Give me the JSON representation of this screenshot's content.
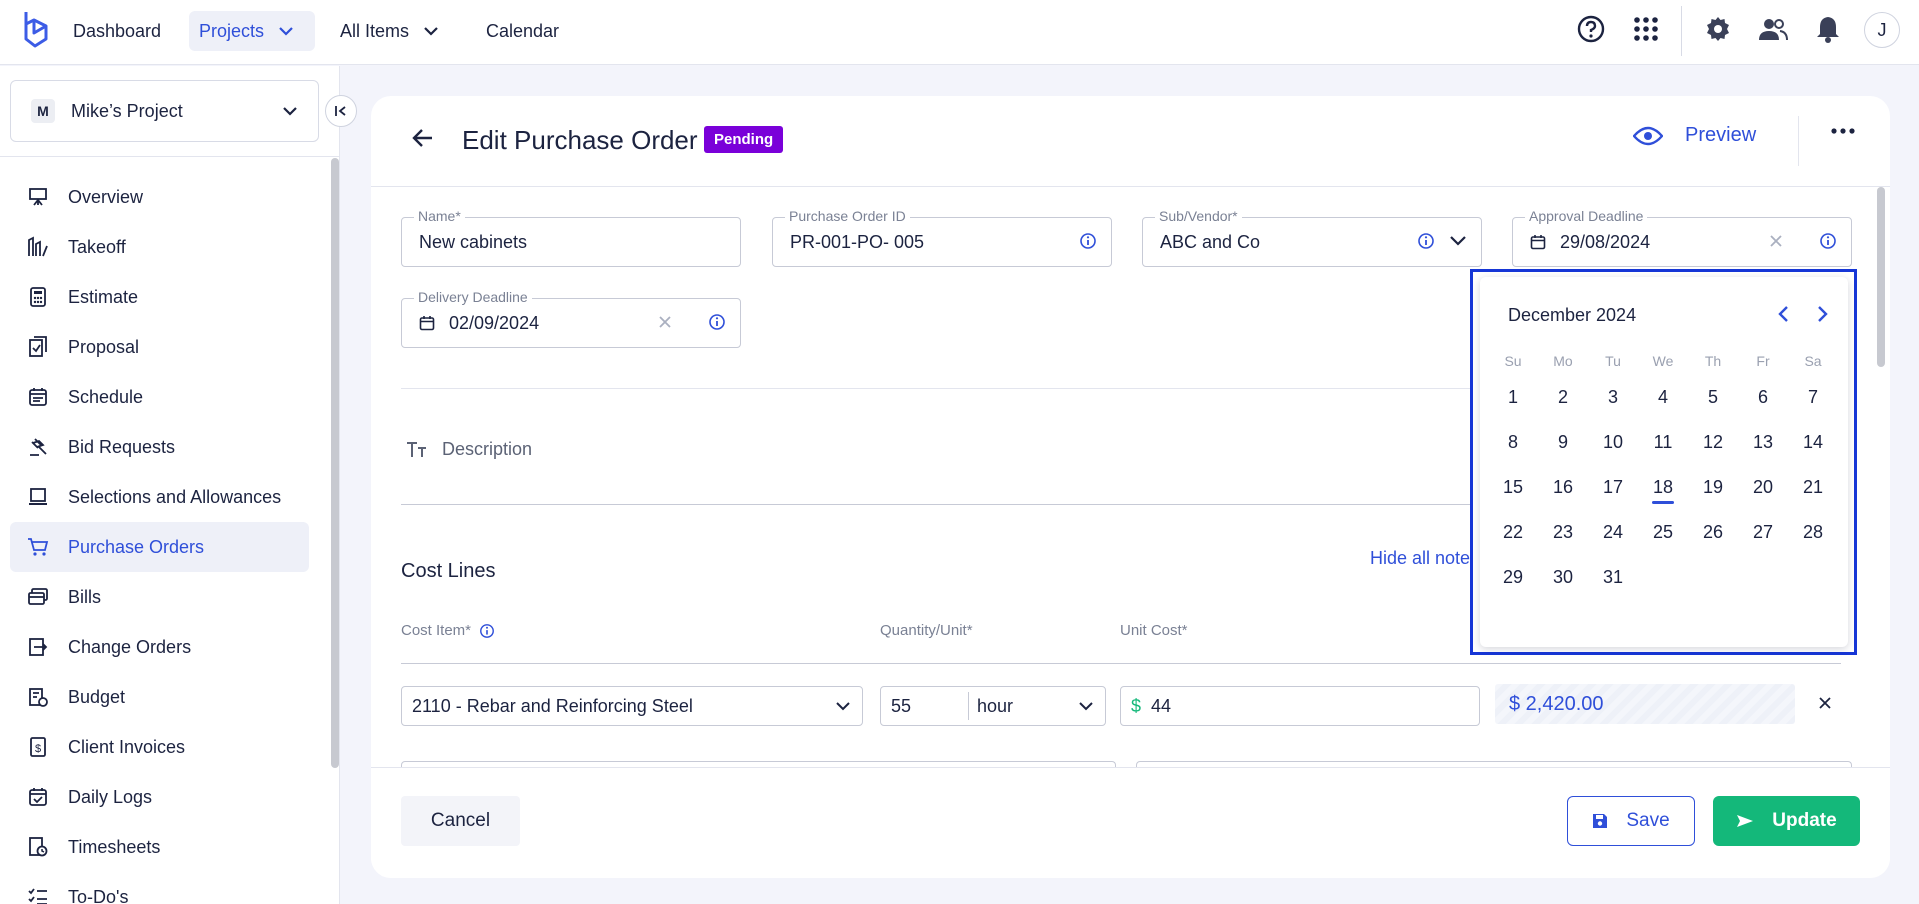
{
  "topnav": {
    "dashboard": "Dashboard",
    "projects": "Projects",
    "all_items": "All Items",
    "calendar": "Calendar",
    "avatar_initial": "J"
  },
  "sidebar": {
    "project_initial": "M",
    "project_name": "Mike’s Project",
    "items": [
      {
        "label": "Overview",
        "icon": "easel-icon"
      },
      {
        "label": "Takeoff",
        "icon": "takeoff-icon"
      },
      {
        "label": "Estimate",
        "icon": "calculator-icon"
      },
      {
        "label": "Proposal",
        "icon": "document-check-icon"
      },
      {
        "label": "Schedule",
        "icon": "calendar-icon"
      },
      {
        "label": "Bid Requests",
        "icon": "gavel-icon"
      },
      {
        "label": "Selections and Allowances",
        "icon": "laptop-icon"
      },
      {
        "label": "Purchase Orders",
        "icon": "cart-icon"
      },
      {
        "label": "Bills",
        "icon": "bills-icon"
      },
      {
        "label": "Change Orders",
        "icon": "change-order-icon"
      },
      {
        "label": "Budget",
        "icon": "budget-icon"
      },
      {
        "label": "Client Invoices",
        "icon": "invoice-icon"
      },
      {
        "label": "Daily Logs",
        "icon": "calendar-check-icon"
      },
      {
        "label": "Timesheets",
        "icon": "timesheet-icon"
      },
      {
        "label": "To-Do's",
        "icon": "checklist-icon"
      }
    ],
    "active_index": 7
  },
  "header": {
    "title": "Edit Purchase Order",
    "status": "Pending",
    "preview": "Preview"
  },
  "form": {
    "name_label": "Name*",
    "name_value": "New cabinets",
    "po_id_label": "Purchase Order ID",
    "po_id_value": "PR-001-PO- 005",
    "vendor_label": "Sub/Vendor*",
    "vendor_value": "ABC and Co",
    "approval_label": "Approval Deadline",
    "approval_value": "29/08/2024",
    "delivery_label": "Delivery Deadline",
    "delivery_value": "02/09/2024",
    "description_placeholder": "Description"
  },
  "cost_lines": {
    "title": "Cost Lines",
    "hide_notes": "Hide all notes",
    "col_cost_item": "Cost Item*",
    "col_quantity": "Quantity/Unit*",
    "col_unit_cost": "Unit Cost*",
    "row": {
      "cost_item": "2110 - Rebar and Reinforcing Steel",
      "quantity": "55",
      "unit": "hour",
      "currency": "$",
      "unit_cost": "44",
      "total": "$ 2,420.00"
    }
  },
  "footer": {
    "cancel": "Cancel",
    "save": "Save",
    "update": "Update"
  },
  "calendar": {
    "month_label": "December 2024",
    "weekdays": [
      "Su",
      "Mo",
      "Tu",
      "We",
      "Th",
      "Fr",
      "Sa"
    ],
    "weeks": [
      [
        "1",
        "2",
        "3",
        "4",
        "5",
        "6",
        "7"
      ],
      [
        "8",
        "9",
        "10",
        "11",
        "12",
        "13",
        "14"
      ],
      [
        "15",
        "16",
        "17",
        "18",
        "19",
        "20",
        "21"
      ],
      [
        "22",
        "23",
        "24",
        "25",
        "26",
        "27",
        "28"
      ],
      [
        "29",
        "30",
        "31",
        "",
        "",
        "",
        ""
      ]
    ],
    "today": "18"
  },
  "colors": {
    "accent": "#2f4fd9",
    "pending_badge": "#7a00d9",
    "update_button": "#14b87a",
    "calendar_highlight_border": "#1636d6"
  }
}
